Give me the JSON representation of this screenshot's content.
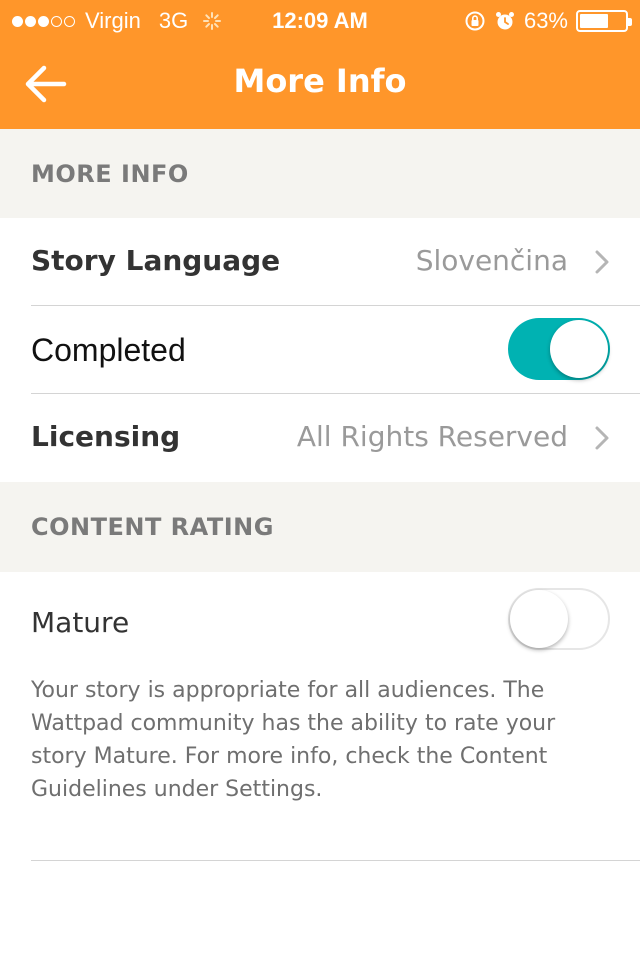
{
  "status_bar": {
    "carrier": "Virgin",
    "network": "3G",
    "time": "12:09 AM",
    "battery_percent": "63%",
    "battery_level": 0.63,
    "signal_bars_on": 3,
    "signal_bars_total": 5
  },
  "nav": {
    "title": "More Info",
    "back_icon": "arrow-left-icon"
  },
  "sections": {
    "more_info": {
      "header": "MORE INFO",
      "story_language": {
        "label": "Story Language",
        "value": "Slovenčina"
      },
      "completed": {
        "label": "Completed",
        "enabled": true
      },
      "licensing": {
        "label": "Licensing",
        "value": "All Rights Reserved"
      }
    },
    "content_rating": {
      "header": "CONTENT RATING",
      "mature": {
        "label": "Mature",
        "enabled": false
      },
      "note": "Your story is appropriate for all audiences. The Wattpad community has the ability to rate your story Mature. For more info, check the Content Guidelines under Settings."
    }
  },
  "colors": {
    "brand_orange": "#FF962A",
    "toggle_on": "#00B2B2",
    "section_bg": "#F5F4F0"
  }
}
